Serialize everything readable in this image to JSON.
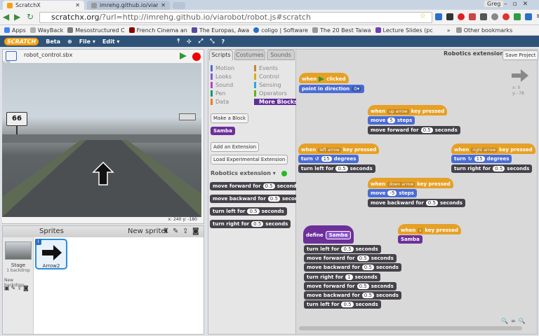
{
  "browser": {
    "tabs": [
      {
        "label": "ScratchX"
      },
      {
        "label": "imrehg.github.io/viarobot"
      }
    ],
    "profile": "Greg",
    "url_host": "scratchx.org",
    "url_rest": "/?url=http://imrehg.github.io/viarobot/robot.js#scratch",
    "bookmarks": [
      {
        "label": "Apps",
        "color": "#4285f4"
      },
      {
        "label": "WayBack",
        "color": "#b0b0b0"
      },
      {
        "label": "Mesostructured C",
        "color": "#7a7a7a"
      },
      {
        "label": "French Cinema an",
        "color": "#8b0000"
      },
      {
        "label": "The Europas, Awa",
        "color": "#5b4a9c"
      },
      {
        "label": "coligo | Software",
        "color": "#2a6fc9"
      },
      {
        "label": "The 20 Best Taiwa",
        "color": "#999999"
      },
      {
        "label": "Lecture Slides (pc",
        "color": "#6f3fb5"
      }
    ],
    "other_bookmarks": "Other bookmarks",
    "overflow": "»"
  },
  "scratch": {
    "logo": "SCRATCH",
    "beta": "Beta",
    "menus": [
      "File ▾",
      "Edit ▾"
    ],
    "extension_title": "Robotics extension",
    "save_project": "Save Project"
  },
  "stage": {
    "project_name": "robot_control.sbx",
    "version_tag": "v.48",
    "coords": "x: 240  y: -180",
    "sign": "66"
  },
  "sprites_pane": {
    "title": "Sprites",
    "new_sprite": "New sprite:",
    "stage_label": "Stage",
    "stage_sub": "1 backdrop",
    "new_backdrop": "New backdrop:",
    "sprite_name": "Arrow2",
    "sprite_badge": "i"
  },
  "tabs": [
    "Scripts",
    "Costumes",
    "Sounds"
  ],
  "categories": [
    {
      "label": "Motion",
      "color": "#4a6cd4"
    },
    {
      "label": "Events",
      "color": "#c88330"
    },
    {
      "label": "Looks",
      "color": "#8a55d7"
    },
    {
      "label": "Control",
      "color": "#e1a91a"
    },
    {
      "label": "Sound",
      "color": "#bb42c3"
    },
    {
      "label": "Sensing",
      "color": "#2ca5e2"
    },
    {
      "label": "Pen",
      "color": "#0e9a6c"
    },
    {
      "label": "Operators",
      "color": "#5cb712"
    },
    {
      "label": "Data",
      "color": "#ee7d16"
    },
    {
      "label": "More Blocks",
      "color": "#632d99"
    }
  ],
  "palette": {
    "make_block": "Make a Block",
    "custom_block": "Samba",
    "add_extension": "Add an Extension",
    "load_experimental": "Load Experimental Extension",
    "robotics_header": "Robotics extension ▾",
    "status_color": "#22bb22",
    "robot_blocks": [
      {
        "pre": "move forward for",
        "val": "0.5",
        "post": "seconds"
      },
      {
        "pre": "move backward for",
        "val": "0.5",
        "post": "seconds"
      },
      {
        "pre": "turn left for",
        "val": "0.5",
        "post": "seconds"
      },
      {
        "pre": "turn right for",
        "val": "0.5",
        "post": "seconds"
      }
    ]
  },
  "script_area": {
    "sprite_info": "x: 0\ny: -78",
    "zoom": [
      "🔍",
      "=",
      "🔍"
    ],
    "flag_script": {
      "hat_pre": "when",
      "hat_post": "clicked",
      "body_pre": "point in direction",
      "body_val": "0▾"
    },
    "up_script": {
      "hat_pre": "when",
      "key": "up arrow",
      "hat_post": "key pressed",
      "move_pre": "move",
      "move_val": "5",
      "move_post": "steps",
      "fwd_pre": "move forward for",
      "fwd_val": "0.5",
      "fwd_post": "seconds"
    },
    "left_script": {
      "hat_pre": "when",
      "key": "left arrow",
      "hat_post": "key pressed",
      "turn_pre": "turn",
      "turn_val": "15",
      "turn_post": "degrees",
      "tl_pre": "turn left for",
      "tl_val": "0.5",
      "tl_post": "seconds"
    },
    "right_script": {
      "hat_pre": "when",
      "key": "right arrow",
      "hat_post": "key pressed",
      "turn_pre": "turn",
      "turn_val": "15",
      "turn_post": "degrees",
      "tr_pre": "turn right for",
      "tr_val": "0.5",
      "tr_post": "seconds"
    },
    "down_script": {
      "hat_pre": "when",
      "key": "down arrow",
      "hat_post": "key pressed",
      "move_pre": "move",
      "move_val": "-5",
      "move_post": "steps",
      "back_pre": "move backward for",
      "back_val": "0.5",
      "back_post": "seconds"
    },
    "s_script": {
      "hat_pre": "when",
      "key": "s",
      "hat_post": "key pressed",
      "call": "Samba"
    },
    "define": {
      "label": "define",
      "name": "Samba"
    },
    "samba_steps": [
      {
        "pre": "turn left for",
        "val": "0.5",
        "post": "seconds"
      },
      {
        "pre": "move forward for",
        "val": "0.5",
        "post": "seconds"
      },
      {
        "pre": "move backward for",
        "val": "0.5",
        "post": "seconds"
      },
      {
        "pre": "turn right for",
        "val": "1",
        "post": "seconds"
      },
      {
        "pre": "move forward for",
        "val": "0.5",
        "post": "seconds"
      },
      {
        "pre": "move backward for",
        "val": "0.5",
        "post": "seconds"
      },
      {
        "pre": "turn left for",
        "val": "0.5",
        "post": "seconds"
      }
    ]
  }
}
